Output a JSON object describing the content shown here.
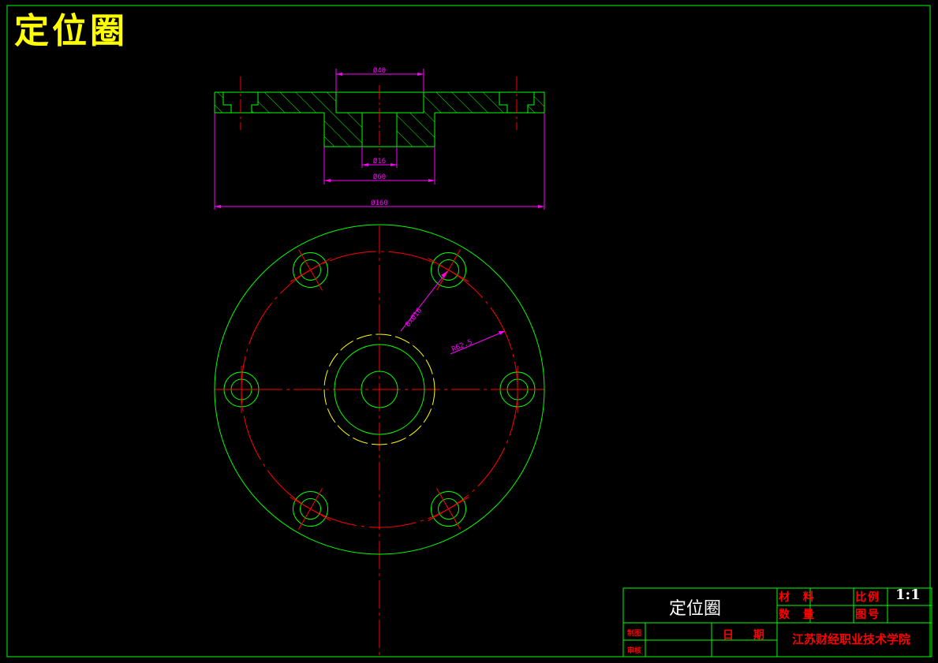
{
  "drawing": {
    "title": "定位圈"
  },
  "dimensions": {
    "d40": "Ø40",
    "d16": "Ø16",
    "d60": "Ø60",
    "d160": "Ø160",
    "bolt_circle": "6xØ16",
    "radius": "R62.5"
  },
  "title_block": {
    "part_name": "定位圈",
    "material_label": "材 料",
    "quantity_label": "数 量",
    "scale_label": "比例",
    "scale_value": "1:1",
    "drawing_no_label": "图号",
    "drawn_by_label": "制图",
    "checked_by_label": "审核",
    "date_label": "日 期",
    "school": "江苏财经职业技术学院"
  },
  "colors": {
    "background": "#000000",
    "outline": "#00ff00",
    "centerline": "#ff0000",
    "dimension": "#ff00ff",
    "hidden": "#ffff00",
    "title": "#ffff00"
  }
}
